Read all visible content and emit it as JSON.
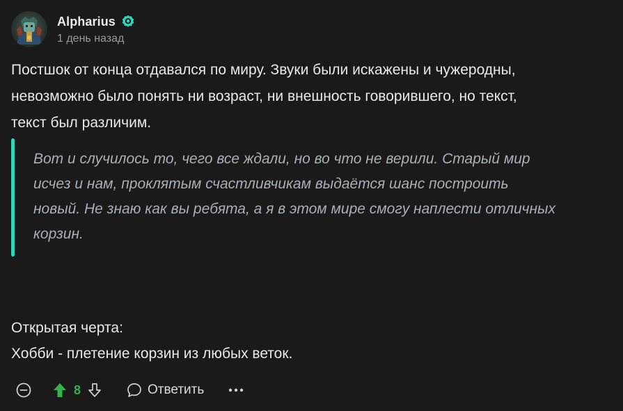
{
  "author": {
    "name": "Alpharius",
    "timestamp": "1 день назад",
    "verified_color": "#2fd6b9",
    "avatar_icon": "avatar-image"
  },
  "post": {
    "lines": [
      "Постшок от конца отдавался по миру. Звуки были искажены и чужеродны,",
      "невозможно было понять ни возраст, ни внешность говорившего, но текст,",
      "текст был различим."
    ],
    "quote_lines": [
      "Вот и случилось то, чего все ждали, но во что не верили. Старый мир",
      "исчез и нам, проклятым счастливчикам выдаётся шанс построить",
      "новый. Не знаю как вы ребята, а я в этом мире смогу наплести отличных",
      "корзин."
    ],
    "quote_accent": "#2fd6b9",
    "trait_heading": "Открытая черта:",
    "trait_text": "Хобби - плетение корзин из любых веток."
  },
  "actions": {
    "collapse_icon": "minus-circle-icon",
    "upvote_icon": "arrow-up-icon",
    "upvote_color": "#35b24a",
    "vote_count": "8",
    "downvote_icon": "arrow-down-icon",
    "reply_icon": "speech-bubble-icon",
    "reply_label": "Ответить",
    "more_icon": "more-dots-icon"
  }
}
